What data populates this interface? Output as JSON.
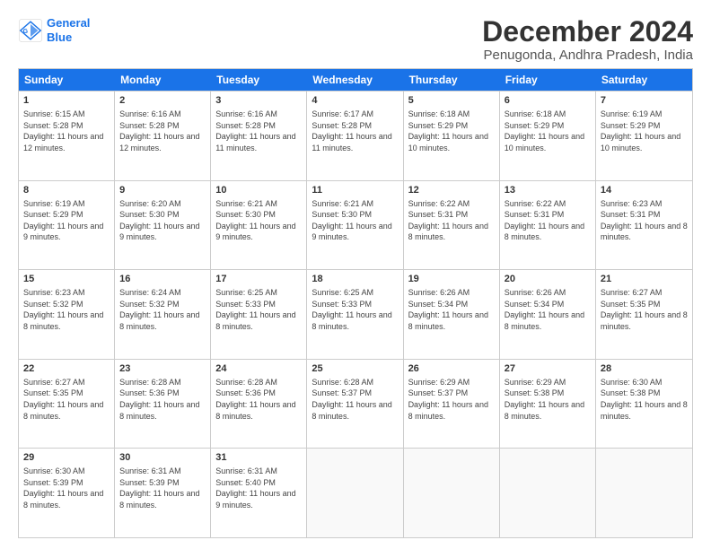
{
  "logo": {
    "line1": "General",
    "line2": "Blue"
  },
  "title": "December 2024",
  "subtitle": "Penugonda, Andhra Pradesh, India",
  "header_days": [
    "Sunday",
    "Monday",
    "Tuesday",
    "Wednesday",
    "Thursday",
    "Friday",
    "Saturday"
  ],
  "weeks": [
    [
      {
        "day": "1",
        "rise": "Sunrise: 6:15 AM",
        "set": "Sunset: 5:28 PM",
        "daylight": "Daylight: 11 hours and 12 minutes."
      },
      {
        "day": "2",
        "rise": "Sunrise: 6:16 AM",
        "set": "Sunset: 5:28 PM",
        "daylight": "Daylight: 11 hours and 12 minutes."
      },
      {
        "day": "3",
        "rise": "Sunrise: 6:16 AM",
        "set": "Sunset: 5:28 PM",
        "daylight": "Daylight: 11 hours and 11 minutes."
      },
      {
        "day": "4",
        "rise": "Sunrise: 6:17 AM",
        "set": "Sunset: 5:28 PM",
        "daylight": "Daylight: 11 hours and 11 minutes."
      },
      {
        "day": "5",
        "rise": "Sunrise: 6:18 AM",
        "set": "Sunset: 5:29 PM",
        "daylight": "Daylight: 11 hours and 10 minutes."
      },
      {
        "day": "6",
        "rise": "Sunrise: 6:18 AM",
        "set": "Sunset: 5:29 PM",
        "daylight": "Daylight: 11 hours and 10 minutes."
      },
      {
        "day": "7",
        "rise": "Sunrise: 6:19 AM",
        "set": "Sunset: 5:29 PM",
        "daylight": "Daylight: 11 hours and 10 minutes."
      }
    ],
    [
      {
        "day": "8",
        "rise": "Sunrise: 6:19 AM",
        "set": "Sunset: 5:29 PM",
        "daylight": "Daylight: 11 hours and 9 minutes."
      },
      {
        "day": "9",
        "rise": "Sunrise: 6:20 AM",
        "set": "Sunset: 5:30 PM",
        "daylight": "Daylight: 11 hours and 9 minutes."
      },
      {
        "day": "10",
        "rise": "Sunrise: 6:21 AM",
        "set": "Sunset: 5:30 PM",
        "daylight": "Daylight: 11 hours and 9 minutes."
      },
      {
        "day": "11",
        "rise": "Sunrise: 6:21 AM",
        "set": "Sunset: 5:30 PM",
        "daylight": "Daylight: 11 hours and 9 minutes."
      },
      {
        "day": "12",
        "rise": "Sunrise: 6:22 AM",
        "set": "Sunset: 5:31 PM",
        "daylight": "Daylight: 11 hours and 8 minutes."
      },
      {
        "day": "13",
        "rise": "Sunrise: 6:22 AM",
        "set": "Sunset: 5:31 PM",
        "daylight": "Daylight: 11 hours and 8 minutes."
      },
      {
        "day": "14",
        "rise": "Sunrise: 6:23 AM",
        "set": "Sunset: 5:31 PM",
        "daylight": "Daylight: 11 hours and 8 minutes."
      }
    ],
    [
      {
        "day": "15",
        "rise": "Sunrise: 6:23 AM",
        "set": "Sunset: 5:32 PM",
        "daylight": "Daylight: 11 hours and 8 minutes."
      },
      {
        "day": "16",
        "rise": "Sunrise: 6:24 AM",
        "set": "Sunset: 5:32 PM",
        "daylight": "Daylight: 11 hours and 8 minutes."
      },
      {
        "day": "17",
        "rise": "Sunrise: 6:25 AM",
        "set": "Sunset: 5:33 PM",
        "daylight": "Daylight: 11 hours and 8 minutes."
      },
      {
        "day": "18",
        "rise": "Sunrise: 6:25 AM",
        "set": "Sunset: 5:33 PM",
        "daylight": "Daylight: 11 hours and 8 minutes."
      },
      {
        "day": "19",
        "rise": "Sunrise: 6:26 AM",
        "set": "Sunset: 5:34 PM",
        "daylight": "Daylight: 11 hours and 8 minutes."
      },
      {
        "day": "20",
        "rise": "Sunrise: 6:26 AM",
        "set": "Sunset: 5:34 PM",
        "daylight": "Daylight: 11 hours and 8 minutes."
      },
      {
        "day": "21",
        "rise": "Sunrise: 6:27 AM",
        "set": "Sunset: 5:35 PM",
        "daylight": "Daylight: 11 hours and 8 minutes."
      }
    ],
    [
      {
        "day": "22",
        "rise": "Sunrise: 6:27 AM",
        "set": "Sunset: 5:35 PM",
        "daylight": "Daylight: 11 hours and 8 minutes."
      },
      {
        "day": "23",
        "rise": "Sunrise: 6:28 AM",
        "set": "Sunset: 5:36 PM",
        "daylight": "Daylight: 11 hours and 8 minutes."
      },
      {
        "day": "24",
        "rise": "Sunrise: 6:28 AM",
        "set": "Sunset: 5:36 PM",
        "daylight": "Daylight: 11 hours and 8 minutes."
      },
      {
        "day": "25",
        "rise": "Sunrise: 6:28 AM",
        "set": "Sunset: 5:37 PM",
        "daylight": "Daylight: 11 hours and 8 minutes."
      },
      {
        "day": "26",
        "rise": "Sunrise: 6:29 AM",
        "set": "Sunset: 5:37 PM",
        "daylight": "Daylight: 11 hours and 8 minutes."
      },
      {
        "day": "27",
        "rise": "Sunrise: 6:29 AM",
        "set": "Sunset: 5:38 PM",
        "daylight": "Daylight: 11 hours and 8 minutes."
      },
      {
        "day": "28",
        "rise": "Sunrise: 6:30 AM",
        "set": "Sunset: 5:38 PM",
        "daylight": "Daylight: 11 hours and 8 minutes."
      }
    ],
    [
      {
        "day": "29",
        "rise": "Sunrise: 6:30 AM",
        "set": "Sunset: 5:39 PM",
        "daylight": "Daylight: 11 hours and 8 minutes."
      },
      {
        "day": "30",
        "rise": "Sunrise: 6:31 AM",
        "set": "Sunset: 5:39 PM",
        "daylight": "Daylight: 11 hours and 8 minutes."
      },
      {
        "day": "31",
        "rise": "Sunrise: 6:31 AM",
        "set": "Sunset: 5:40 PM",
        "daylight": "Daylight: 11 hours and 9 minutes."
      },
      {
        "day": "",
        "rise": "",
        "set": "",
        "daylight": ""
      },
      {
        "day": "",
        "rise": "",
        "set": "",
        "daylight": ""
      },
      {
        "day": "",
        "rise": "",
        "set": "",
        "daylight": ""
      },
      {
        "day": "",
        "rise": "",
        "set": "",
        "daylight": ""
      }
    ]
  ]
}
